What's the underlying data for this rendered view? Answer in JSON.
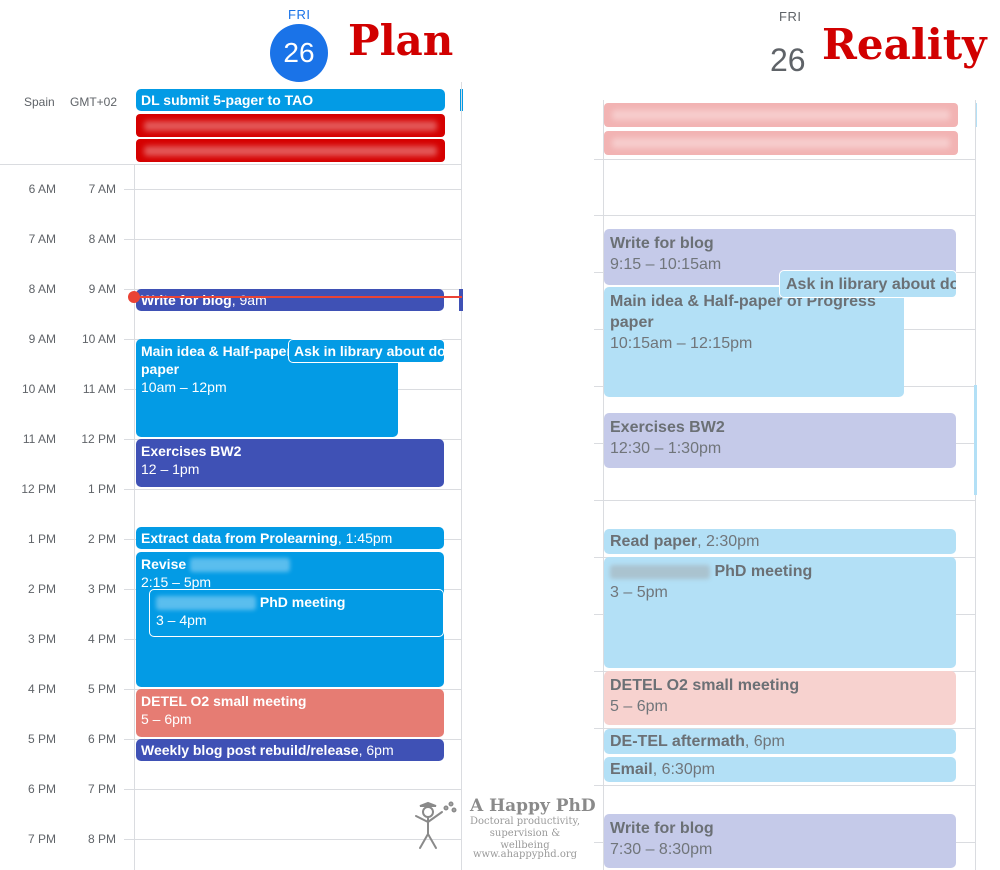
{
  "plan": {
    "heading": "Plan",
    "day_of_week": "FRI",
    "day_number": "26",
    "timezone_primary": "Spain",
    "timezone_secondary": "GMT+02",
    "time_rows": [
      {
        "primary": "6 AM",
        "secondary": "7 AM"
      },
      {
        "primary": "7 AM",
        "secondary": "8 AM"
      },
      {
        "primary": "8 AM",
        "secondary": "9 AM"
      },
      {
        "primary": "9 AM",
        "secondary": "10 AM"
      },
      {
        "primary": "10 AM",
        "secondary": "11 AM"
      },
      {
        "primary": "11 AM",
        "secondary": "12 PM"
      },
      {
        "primary": "12 PM",
        "secondary": "1 PM"
      },
      {
        "primary": "1 PM",
        "secondary": "2 PM"
      },
      {
        "primary": "2 PM",
        "secondary": "3 PM"
      },
      {
        "primary": "3 PM",
        "secondary": "4 PM"
      },
      {
        "primary": "4 PM",
        "secondary": "5 PM"
      },
      {
        "primary": "5 PM",
        "secondary": "6 PM"
      },
      {
        "primary": "6 PM",
        "secondary": "7 PM"
      },
      {
        "primary": "7 PM",
        "secondary": "8 PM"
      }
    ],
    "all_day_event": "DL submit 5-pager to TAO",
    "events": {
      "write_blog": {
        "title": "Write for blog",
        "time": ", 9am"
      },
      "main_idea": {
        "title": "Main idea & Half-paper of Progress",
        "title2": "paper",
        "time": "10am – 12pm"
      },
      "ask_library": {
        "title": "Ask in library about document delivery"
      },
      "exercises": {
        "title": "Exercises BW2",
        "time": "12 – 1pm"
      },
      "extract": {
        "title": "Extract data from Prolearning",
        "time": ", 1:45pm"
      },
      "revise": {
        "title": "Revise",
        "time": "2:15 – 5pm"
      },
      "phd_meeting": {
        "title": "PhD meeting",
        "time": "3 – 4pm"
      },
      "detel": {
        "title": "DETEL O2 small meeting",
        "time": "5 – 6pm"
      },
      "weekly_blog": {
        "title": "Weekly blog post rebuild/release",
        "time": ", 6pm"
      }
    }
  },
  "reality": {
    "heading": "Reality",
    "day_of_week": "FRI",
    "day_number": "26",
    "events": {
      "write_blog": {
        "title": "Write for blog",
        "time": "9:15 – 10:15am"
      },
      "ask_library": {
        "title": "Ask in library about document delivery"
      },
      "main_idea": {
        "title": "Main idea & Half-paper of Progress",
        "title2": "paper",
        "time": "10:15am – 12:15pm"
      },
      "exercises": {
        "title": "Exercises BW2",
        "time": "12:30 – 1:30pm"
      },
      "read_paper": {
        "title": "Read paper",
        "time": ", 2:30pm"
      },
      "phd_meeting": {
        "title": "PhD meeting",
        "time": "3 – 5pm"
      },
      "detel": {
        "title": "DETEL O2 small meeting",
        "time": "5 – 6pm"
      },
      "detel_aftermath": {
        "title": "DE-TEL aftermath",
        "time": ", 6pm"
      },
      "email": {
        "title": "Email",
        "time": ", 6:30pm"
      },
      "write_blog_evening": {
        "title": "Write for blog",
        "time": "7:30 – 8:30pm"
      }
    }
  },
  "watermark": {
    "title": "A Happy PhD",
    "tagline1": "Doctoral productivity,",
    "tagline2": "supervision & wellbeing",
    "url": "www.ahappyphd.org"
  },
  "colors": {
    "heading_red": "#d10000",
    "today_blue": "#1a73e8",
    "event_blue": "#039be5",
    "event_indigo": "#3f51b5",
    "event_salmon": "#e67c73",
    "event_red": "#d50000",
    "now_line": "#ea4335"
  }
}
